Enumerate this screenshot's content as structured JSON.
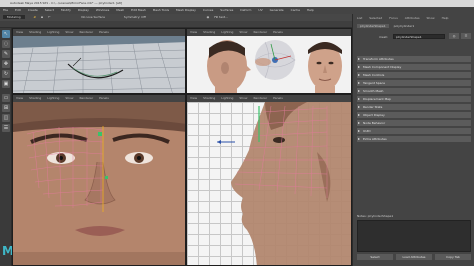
{
  "window": {
    "title": "Autodesk Maya 2015 SP1 - C:\\...\\scenes\\MirrorFace.mb*  ---  pCylinder1 [alt]"
  },
  "menubar": {
    "items": [
      "File",
      "Edit",
      "Create",
      "Select",
      "Modify",
      "Display",
      "Windows",
      "Mesh",
      "Edit Mesh",
      "Mesh Tools",
      "Mesh Display",
      "Curves",
      "Surfaces",
      "Deform",
      "UV",
      "Generate",
      "Cache",
      "Help"
    ]
  },
  "statusline": {
    "mode": "Modeling",
    "live_surface": "No Live Surface",
    "symmetry": "Symmetry: Off",
    "extra": "Fill text..."
  },
  "viewports": {
    "top_left": {
      "menu": [
        "View",
        "Shading",
        "Lighting",
        "Show",
        "Renderer",
        "Panels"
      ]
    },
    "top_right": {
      "menu": [
        "View",
        "Shading",
        "Lighting",
        "Show",
        "Renderer",
        "Panels"
      ]
    },
    "bottom_left": {
      "menu": [
        "View",
        "Shading",
        "Lighting",
        "Show",
        "Renderer",
        "Panels"
      ]
    },
    "bottom_right": {
      "menu": [
        "View",
        "Shading",
        "Lighting",
        "Show",
        "Renderer",
        "Panels"
      ]
    }
  },
  "attribute_editor": {
    "tabs": [
      "List",
      "Selected",
      "Focus",
      "Attributes",
      "Show",
      "Help"
    ],
    "node_tabs": [
      "pCylinderShape1",
      "polyCylinder1"
    ],
    "mesh_label": "mesh:",
    "mesh_value": "pCylinderShape1",
    "sections": [
      "Transform Attributes",
      "Mesh Component Display",
      "Mesh Controls",
      "Tangent Space",
      "Smooth Mesh",
      "Displacement Map",
      "Render Stats",
      "Object Display",
      "Node Behavior",
      "UUID",
      "Extra Attributes"
    ],
    "notes_label": "Notes: pCylinderShape1",
    "buttons": [
      "Select",
      "Load Attributes",
      "Copy Tab"
    ]
  },
  "colors": {
    "accent": "#5285a6",
    "maya_logo": "#3fb7c7",
    "wire": "#e07b9a"
  }
}
